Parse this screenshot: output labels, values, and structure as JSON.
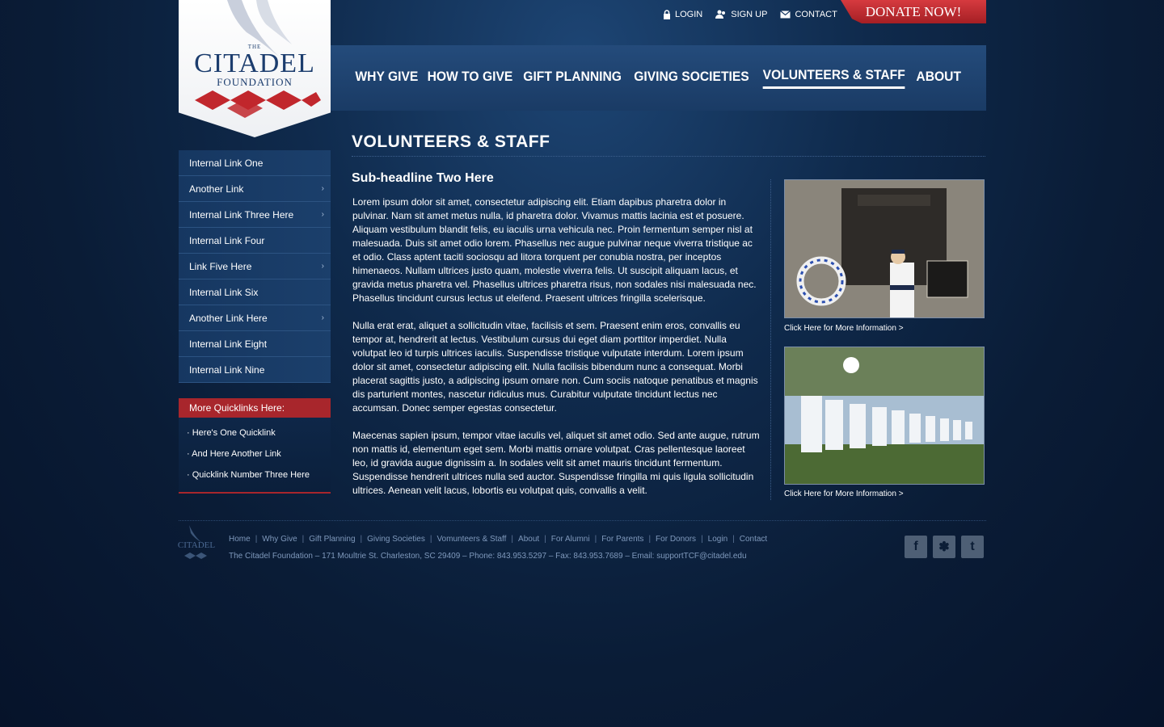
{
  "util": {
    "login": "LOGIN",
    "signup": "SIGN UP",
    "contact": "CONTACT",
    "donate": "DONATE NOW!"
  },
  "logo": {
    "top": "THE",
    "name": "CITADEL",
    "sub": "FOUNDATION"
  },
  "nav": {
    "items": [
      "WHY GIVE",
      "HOW TO GIVE",
      "GIFT PLANNING",
      "GIVING SOCIETIES",
      "VOLUNTEERS & STAFF",
      "ABOUT"
    ],
    "active": "VOLUNTEERS & STAFF"
  },
  "sidebar": {
    "items": [
      {
        "label": "Internal Link One",
        "arrow": ""
      },
      {
        "label": "Another Link",
        "arrow": "›"
      },
      {
        "label": "Internal Link Three Here",
        "arrow": "›"
      },
      {
        "label": "Internal Link Four",
        "arrow": ""
      },
      {
        "label": "Link Five Here",
        "arrow": "›"
      },
      {
        "label": "Internal Link Six",
        "arrow": ""
      },
      {
        "label": "Another Link Here",
        "arrow": "›"
      },
      {
        "label": "Internal Link Eight",
        "arrow": ""
      },
      {
        "label": "Internal Link Nine",
        "arrow": ""
      }
    ]
  },
  "quicklinks": {
    "heading": "More Quicklinks Here:",
    "items": [
      "· Here's One Quicklink",
      "· And Here Another Link",
      "· Quicklink Number Three Here"
    ]
  },
  "main": {
    "title": "VOLUNTEERS & STAFF",
    "subheadline": "Sub-headline Two Here",
    "paragraphs": [
      "Lorem ipsum dolor sit amet, consectetur adipiscing elit. Etiam dapibus pharetra dolor in pulvinar. Nam sit amet metus nulla, id pharetra dolor. Vivamus mattis lacinia est et posuere. Aliquam vestibulum blandit felis, eu iaculis urna vehicula nec. Proin fermentum semper nisl at malesuada. Duis sit amet odio lorem. Phasellus nec augue pulvinar neque viverra tristique ac et odio. Class aptent taciti sociosqu ad litora torquent per conubia nostra, per inceptos himenaeos. Nullam ultrices justo quam, molestie viverra felis. Ut suscipit aliquam lacus, et gravida metus pharetra vel. Phasellus ultrices pharetra risus, non sodales nisi malesuada nec. Phasellus tincidunt cursus lectus ut eleifend. Praesent ultrices fringilla scelerisque.",
      "Nulla erat erat, aliquet a sollicitudin vitae, facilisis et sem. Praesent enim eros, convallis eu tempor at, hendrerit at lectus. Vestibulum cursus dui eget diam porttitor imperdiet. Nulla volutpat leo id turpis ultrices iaculis. Suspendisse tristique vulputate interdum. Lorem ipsum dolor sit amet, consectetur adipiscing elit. Nulla facilisis bibendum nunc a consequat. Morbi placerat sagittis justo, a adipiscing ipsum ornare non. Cum sociis natoque penatibus et magnis dis parturient montes, nascetur ridiculus mus. Curabitur vulputate tincidunt lectus nec accumsan. Donec semper egestas consectetur.",
      "Maecenas sapien ipsum, tempor vitae iaculis vel, aliquet sit amet odio. Sed ante augue, rutrum non mattis id, elementum eget sem. Morbi mattis ornare volutpat. Cras pellentesque laoreet leo, id gravida augue dignissim a. In sodales velit sit amet mauris tincidunt fermentum. Suspendisse hendrerit ultrices nulla sed auctor. Suspendisse fringilla mi quis ligula sollicitudin ultrices. Aenean velit lacus, lobortis eu volutpat quis, convallis a velit."
    ]
  },
  "photos": {
    "link1": "Click Here for More Information >",
    "link2": "Click Here for More Information >"
  },
  "footer": {
    "links": [
      "Home",
      "Why Give",
      "Gift Planning",
      "Giving Societies",
      "Vomunteers & Staff",
      "About",
      "For Alumni",
      "For Parents",
      "For Donors",
      "Login",
      "Contact"
    ],
    "separator": "|",
    "address": "The Citadel Foundation – 171 Moultrie St. Charleston, SC 29409 – Phone: 843.953.5297 – Fax: 843.953.7689 – Email: supportTCF@citadel.edu",
    "logo_text": "CITADEL",
    "social": [
      "facebook-icon",
      "myspace-icon",
      "twitter-icon"
    ],
    "social_glyphs": [
      "f",
      "✽",
      "t"
    ]
  },
  "colors": {
    "accent_red": "#a8262c",
    "nav_bg": "#1f4572",
    "page_bg": "#0a1c36"
  }
}
